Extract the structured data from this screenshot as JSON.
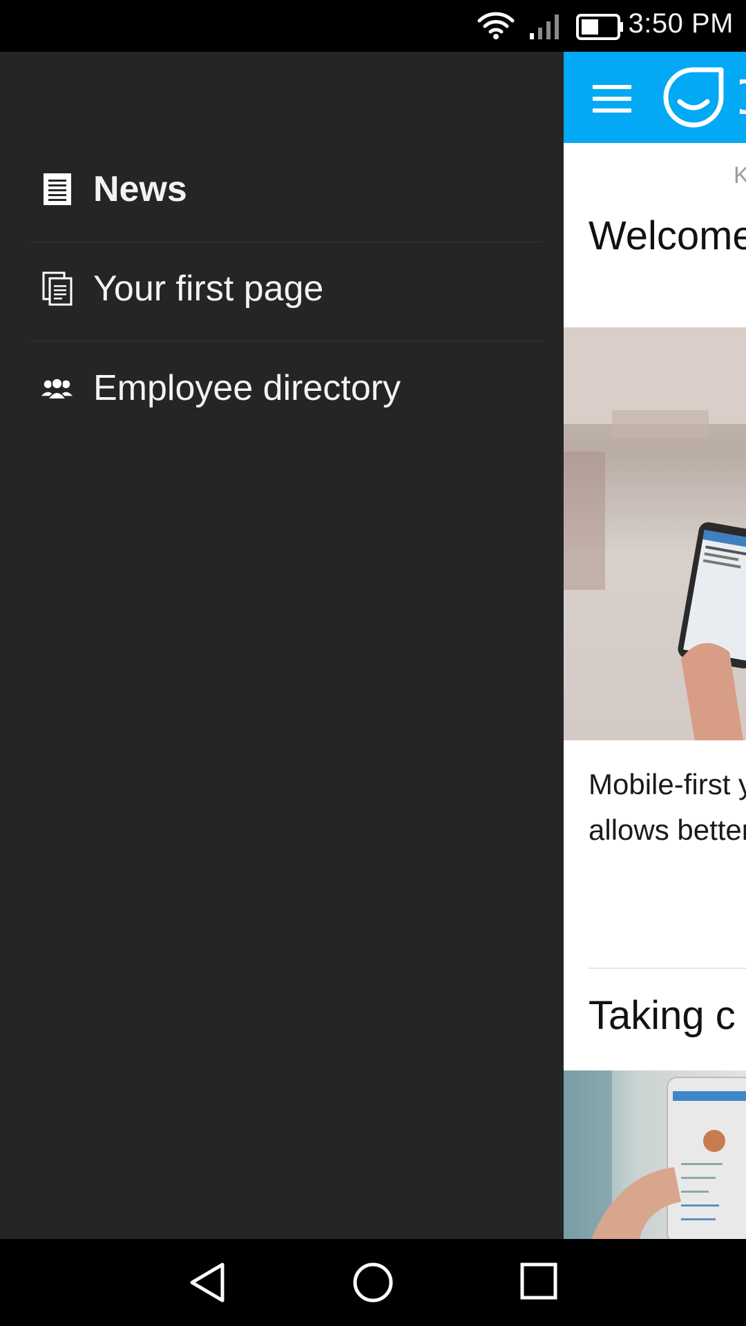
{
  "status_bar": {
    "time": "3:50 PM",
    "icons": [
      "wifi-icon",
      "signal-icon",
      "battery-icon"
    ]
  },
  "drawer": {
    "items": [
      {
        "label": "News",
        "icon": "news-icon",
        "active": true
      },
      {
        "label": "Your first page",
        "icon": "pages-icon",
        "active": false
      },
      {
        "label": "Employee directory",
        "icon": "people-icon",
        "active": false
      }
    ]
  },
  "main": {
    "app_bar": {
      "color": "#03a9f4",
      "menu_icon": "menu-icon",
      "logo_icon": "staffbase-logo-icon"
    },
    "kicker": "K",
    "headline": "Welcome App",
    "body": "Mobile-first you call it: S and allows better than",
    "second_title": "Taking c"
  },
  "nav_bar": {
    "buttons": [
      "back-icon",
      "home-icon",
      "recents-icon"
    ]
  }
}
